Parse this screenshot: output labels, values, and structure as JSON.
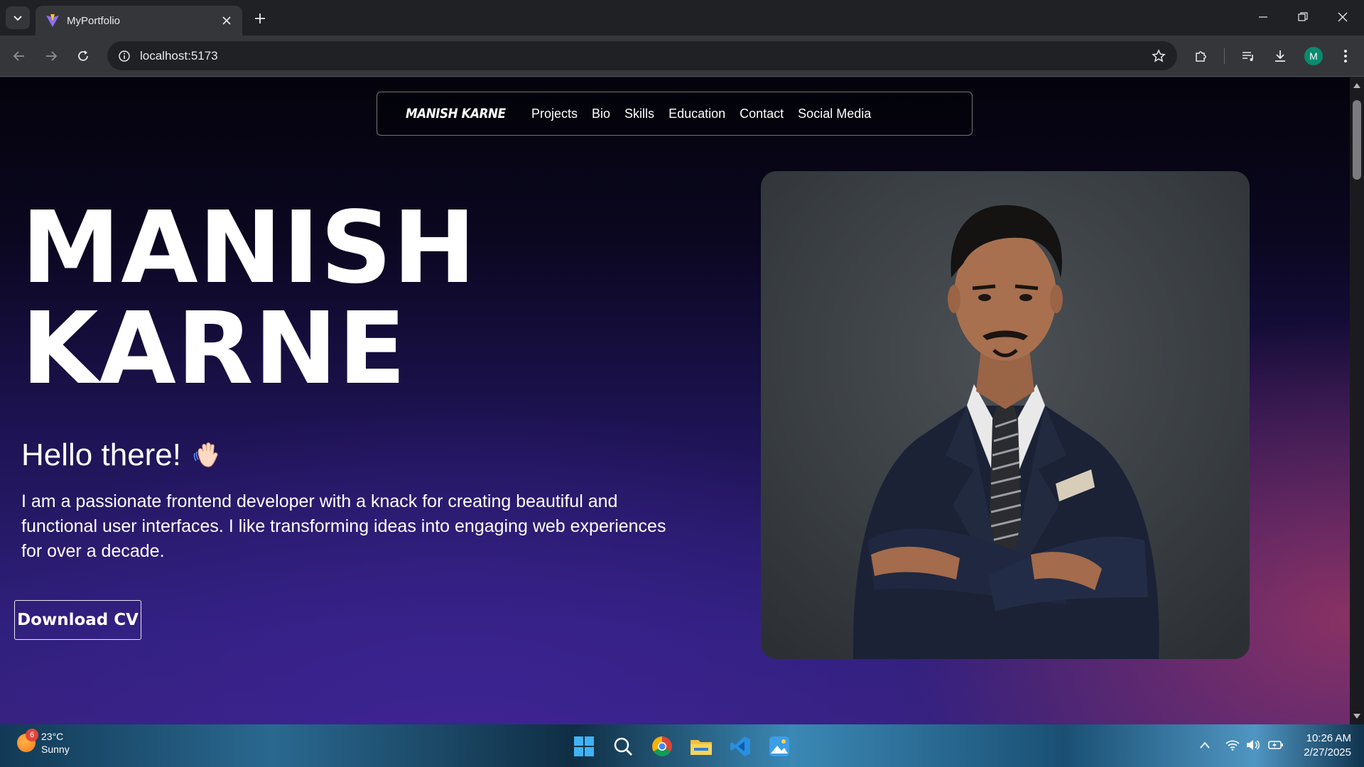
{
  "browser": {
    "tab_title": "MyPortfolio",
    "url": "localhost:5173",
    "profile_initial": "M"
  },
  "page": {
    "brand": "MANISH KARNE",
    "nav": [
      "Projects",
      "Bio",
      "Skills",
      "Education",
      "Contact",
      "Social Media"
    ],
    "hero_first": "MANISH",
    "hero_last": "KARNE",
    "greeting": "Hello there!",
    "bio_text": "I am a passionate frontend developer with a knack for creating beautiful and functional user interfaces. I like transforming ideas into engaging web experiences for over a decade.",
    "cv_button": "Download CV"
  },
  "taskbar": {
    "weather_temp": "23°C",
    "weather_desc": "Sunny",
    "weather_badge": "6",
    "time": "10:26 AM",
    "date": "2/27/2025"
  },
  "colors": {
    "accent_purple": "#35217c",
    "accent_pink": "#a8385c"
  }
}
